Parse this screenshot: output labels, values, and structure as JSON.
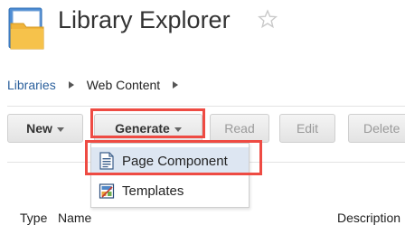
{
  "header": {
    "title": "Library Explorer",
    "icon": "library-folder-icon",
    "favorite_icon": "star-outline-icon"
  },
  "breadcrumb": {
    "items": [
      "Libraries",
      "Web Content"
    ]
  },
  "toolbar": {
    "buttons": [
      {
        "label": "New",
        "has_menu": true
      },
      {
        "label": "Generate",
        "has_menu": true,
        "highlighted": true
      },
      {
        "label": "Read",
        "disabled": true
      },
      {
        "label": "Edit",
        "disabled": true
      },
      {
        "label": "Delete",
        "disabled": true
      }
    ]
  },
  "generate_menu": {
    "items": [
      {
        "label": "Page Component",
        "icon": "document-icon",
        "highlighted": true
      },
      {
        "label": "Templates",
        "icon": "template-icon"
      }
    ]
  },
  "table": {
    "columns": [
      "Type",
      "Name",
      "Description"
    ]
  },
  "colors": {
    "highlight": "#ee4b43",
    "link": "#2a5f9c",
    "menu_hover": "#dde6f2"
  }
}
